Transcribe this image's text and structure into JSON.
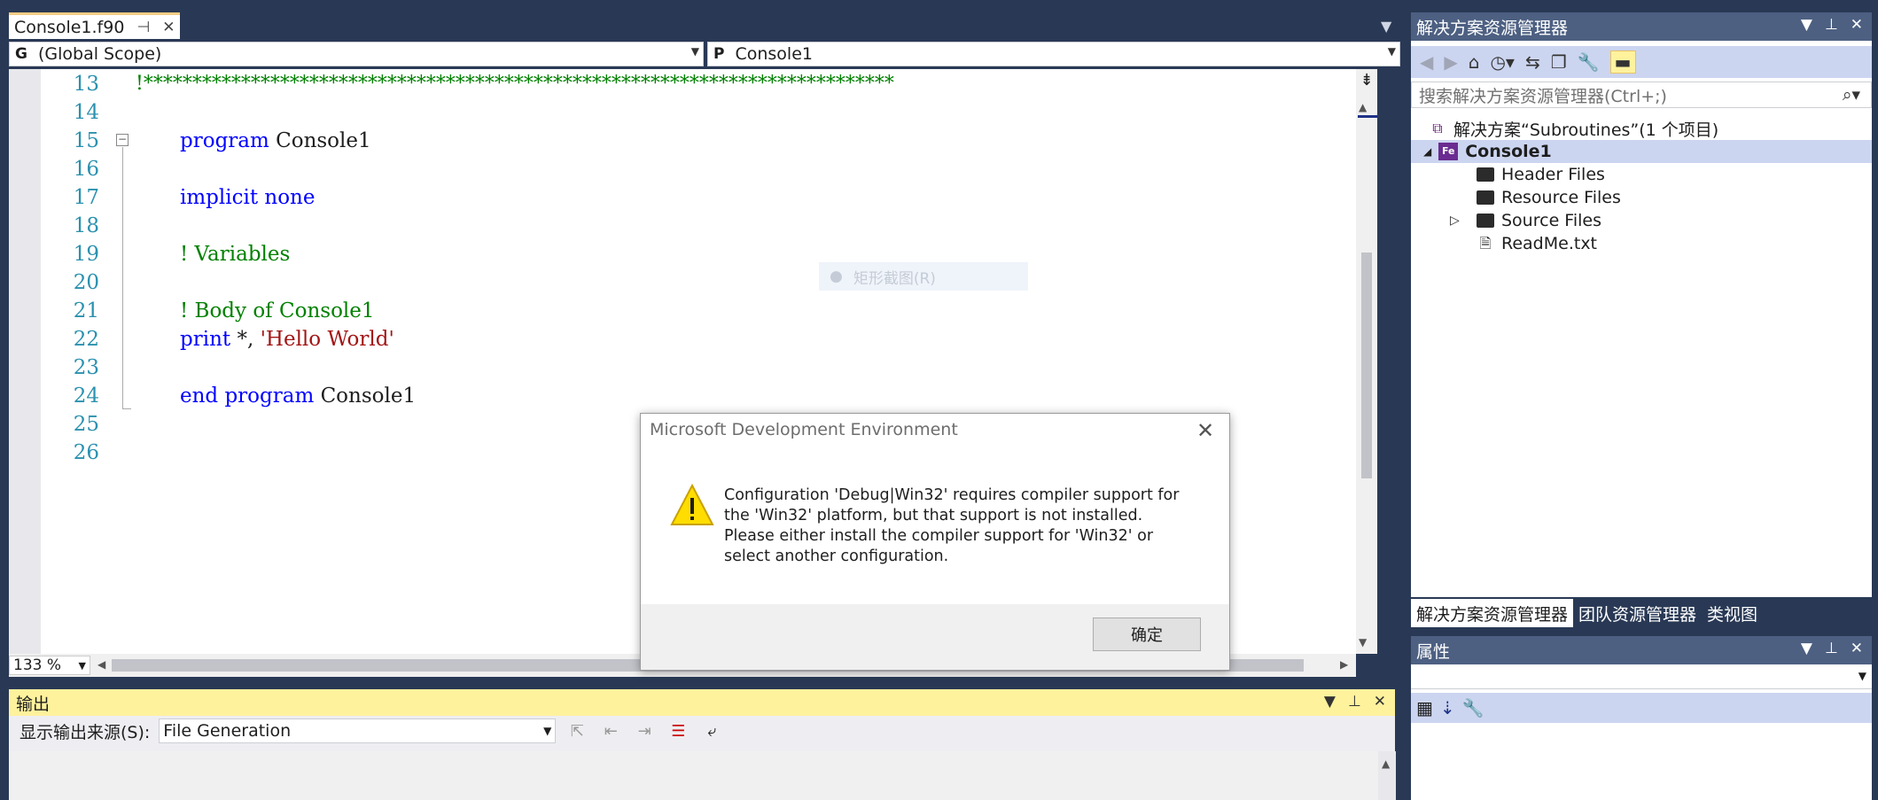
{
  "editor": {
    "tab_label": "Console1.f90",
    "scope_prefix": "G",
    "scope_value": "(Global Scope)",
    "proc_prefix": "P",
    "proc_value": "Console1",
    "zoom": "133 %",
    "lines": [
      {
        "no": "13",
        "text": "!*****************************************************************************"
      },
      {
        "no": "14",
        "text": ""
      },
      {
        "no": "15",
        "kw": "program",
        "rest": " Console1"
      },
      {
        "no": "16",
        "text": ""
      },
      {
        "no": "17",
        "kw": "implicit none",
        "rest": ""
      },
      {
        "no": "18",
        "text": ""
      },
      {
        "no": "19",
        "comment": "! Variables"
      },
      {
        "no": "20",
        "text": ""
      },
      {
        "no": "21",
        "comment": "! Body of Console1"
      },
      {
        "no": "22",
        "kw": "print",
        "mid": " *, ",
        "str": "'Hello World'"
      },
      {
        "no": "23",
        "text": ""
      },
      {
        "no": "24",
        "kw": "end program",
        "rest": " Console1"
      },
      {
        "no": "25",
        "text": ""
      },
      {
        "no": "26",
        "text": ""
      }
    ]
  },
  "output": {
    "title": "输出",
    "source_label": "显示输出来源(S):",
    "source_value": "File Generation"
  },
  "solution_explorer": {
    "title": "解决方案资源管理器",
    "search_placeholder": "搜索解决方案资源管理器(Ctrl+;)",
    "solution": "解决方案“Subroutines”(1 个项目)",
    "project": "Console1",
    "project_icon_text": "Fe",
    "items": [
      "Header Files",
      "Resource Files",
      "Source Files",
      "ReadMe.txt"
    ],
    "tabs": [
      "解决方案资源管理器",
      "团队资源管理器",
      "类视图"
    ]
  },
  "properties": {
    "title": "属性"
  },
  "dialog": {
    "title": "Microsoft Development Environment",
    "message": "Configuration 'Debug|Win32' requires compiler support for the 'Win32' platform, but that support is not installed. Please either install the compiler support for 'Win32' or select another configuration.",
    "ok_label": "确定"
  },
  "ghost_menu": {
    "label": "矩形截图(R)"
  },
  "colors": {
    "chrome": "#293955",
    "panel_title": "#4d6082",
    "output_title_bg": "#fff29d",
    "keyword": "#0000ff",
    "comment": "#008000",
    "string": "#a31515",
    "line_number": "#2b91af"
  },
  "icons": {
    "pin": "pin-icon",
    "close": "close-icon",
    "warning": "warning-icon",
    "search": "search-icon",
    "home": "home-icon",
    "wrench": "wrench-icon"
  }
}
